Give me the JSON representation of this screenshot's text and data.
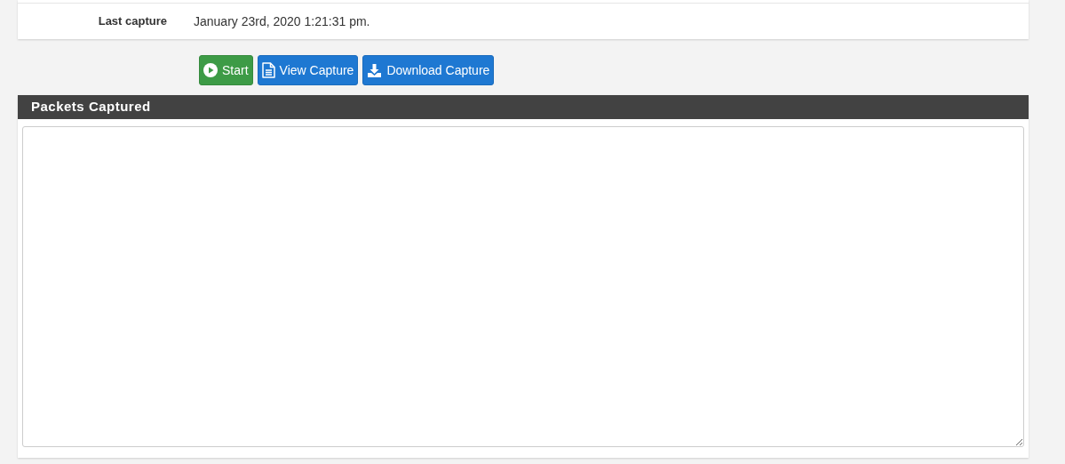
{
  "details": {
    "label": "Last capture",
    "value": "January 23rd, 2020 1:21:31 pm."
  },
  "buttons": [
    {
      "kind": "start",
      "label": "Start"
    },
    {
      "kind": "view",
      "label": "View Capture"
    },
    {
      "kind": "download",
      "label": "Download Capture"
    }
  ],
  "packets_panel": {
    "title": "Packets Captured"
  }
}
